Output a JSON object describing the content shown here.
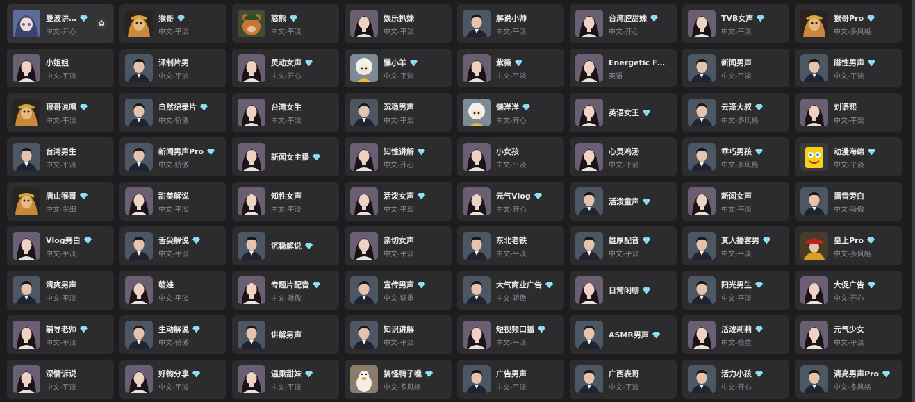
{
  "voices": [
    {
      "name": "曼波讲…",
      "style": "中文-开心",
      "vip": true,
      "avatar": "anime",
      "fav_icon": "flower-icon"
    },
    {
      "name": "猴哥",
      "style": "中文-平淡",
      "vip": true,
      "avatar": "monkey"
    },
    {
      "name": "憨熊",
      "style": "中文-平淡",
      "vip": true,
      "avatar": "bear"
    },
    {
      "name": "娱乐扒妹",
      "style": "中文-平淡",
      "vip": false,
      "avatar": "female"
    },
    {
      "name": "解说小帅",
      "style": "中文-平淡",
      "vip": false,
      "avatar": "male"
    },
    {
      "name": "台湾腔甜妹",
      "style": "中文-开心",
      "vip": true,
      "avatar": "female"
    },
    {
      "name": "TVB女声",
      "style": "中文-平淡",
      "vip": true,
      "avatar": "female"
    },
    {
      "name": "猴哥Pro",
      "style": "中文-多风格",
      "vip": true,
      "avatar": "monkey"
    },
    {
      "name": "小姐姐",
      "style": "中文-平淡",
      "vip": false,
      "avatar": "female"
    },
    {
      "name": "译制片男",
      "style": "中文-平淡",
      "vip": false,
      "avatar": "male"
    },
    {
      "name": "灵动女声",
      "style": "中文-开心",
      "vip": true,
      "avatar": "female"
    },
    {
      "name": "懒小羊",
      "style": "中文-平淡",
      "vip": true,
      "avatar": "sheep"
    },
    {
      "name": "紫薇",
      "style": "中文-平淡",
      "vip": true,
      "avatar": "female"
    },
    {
      "name": "Energetic Fe…",
      "style": "英语",
      "vip": false,
      "avatar": "female"
    },
    {
      "name": "新闻男声",
      "style": "中文-平淡",
      "vip": false,
      "avatar": "male"
    },
    {
      "name": "磁性男声",
      "style": "中文-平淡",
      "vip": true,
      "avatar": "male"
    },
    {
      "name": "猴哥说唱",
      "style": "中文-平淡",
      "vip": true,
      "avatar": "monkey"
    },
    {
      "name": "自然纪录片",
      "style": "中文-骄傲",
      "vip": true,
      "avatar": "male"
    },
    {
      "name": "台湾女生",
      "style": "中文-平淡",
      "vip": false,
      "avatar": "female"
    },
    {
      "name": "沉稳男声",
      "style": "中文-平淡",
      "vip": false,
      "avatar": "male"
    },
    {
      "name": "懒洋洋",
      "style": "中文-开心",
      "vip": true,
      "avatar": "sheep"
    },
    {
      "name": "英语女王",
      "style": "",
      "vip": true,
      "avatar": "female"
    },
    {
      "name": "云泽大叔",
      "style": "中文-多风格",
      "vip": true,
      "avatar": "male"
    },
    {
      "name": "刘语熙",
      "style": "中文-平淡",
      "vip": false,
      "avatar": "female"
    },
    {
      "name": "台湾男生",
      "style": "中文-平淡",
      "vip": false,
      "avatar": "male"
    },
    {
      "name": "新闻男声Pro",
      "style": "中文-骄傲",
      "vip": true,
      "avatar": "male"
    },
    {
      "name": "新闻女主播",
      "style": "",
      "vip": true,
      "avatar": "female"
    },
    {
      "name": "知性讲解",
      "style": "中文-开心",
      "vip": true,
      "avatar": "female"
    },
    {
      "name": "小女孩",
      "style": "中文-平淡",
      "vip": false,
      "avatar": "female"
    },
    {
      "name": "心灵鸡汤",
      "style": "中文-平淡",
      "vip": false,
      "avatar": "female"
    },
    {
      "name": "乖巧男孩",
      "style": "中文-多风格",
      "vip": true,
      "avatar": "male"
    },
    {
      "name": "动漫海绵",
      "style": "中文-平淡",
      "vip": true,
      "avatar": "sponge"
    },
    {
      "name": "唐山猴哥",
      "style": "中文-尖细",
      "vip": true,
      "avatar": "monkey"
    },
    {
      "name": "甜美解说",
      "style": "中文-平淡",
      "vip": false,
      "avatar": "female"
    },
    {
      "name": "知性女声",
      "style": "中文-平淡",
      "vip": false,
      "avatar": "female"
    },
    {
      "name": "活泼女声",
      "style": "中文-平淡",
      "vip": true,
      "avatar": "female"
    },
    {
      "name": "元气Vlog",
      "style": "中文-开心",
      "vip": true,
      "avatar": "female"
    },
    {
      "name": "活泼童声",
      "style": "",
      "vip": true,
      "avatar": "male"
    },
    {
      "name": "新闻女声",
      "style": "中文-平淡",
      "vip": false,
      "avatar": "female"
    },
    {
      "name": "播音旁白",
      "style": "中文-骄傲",
      "vip": false,
      "avatar": "male"
    },
    {
      "name": "Vlog旁白",
      "style": "中文-平淡",
      "vip": true,
      "avatar": "female"
    },
    {
      "name": "舌尖解说",
      "style": "中文-平淡",
      "vip": true,
      "avatar": "male"
    },
    {
      "name": "沉稳解说",
      "style": "",
      "vip": true,
      "avatar": "male"
    },
    {
      "name": "亲切女声",
      "style": "中文-平淡",
      "vip": false,
      "avatar": "female"
    },
    {
      "name": "东北老铁",
      "style": "中文-平淡",
      "vip": false,
      "avatar": "male"
    },
    {
      "name": "雄厚配音",
      "style": "中文-平淡",
      "vip": true,
      "avatar": "male"
    },
    {
      "name": "真人播客男",
      "style": "中文-平淡",
      "vip": true,
      "avatar": "male"
    },
    {
      "name": "皇上Pro",
      "style": "中文-多风格",
      "vip": true,
      "avatar": "emperor"
    },
    {
      "name": "清爽男声",
      "style": "中文-平淡",
      "vip": false,
      "avatar": "male"
    },
    {
      "name": "萌娃",
      "style": "中文-平淡",
      "vip": false,
      "avatar": "female"
    },
    {
      "name": "专题片配音",
      "style": "中文-骄傲",
      "vip": true,
      "avatar": "female"
    },
    {
      "name": "宣传男声",
      "style": "中文-稳重",
      "vip": true,
      "avatar": "male"
    },
    {
      "name": "大气商业广告",
      "style": "中文-骄傲",
      "vip": true,
      "avatar": "male"
    },
    {
      "name": "日常闲聊",
      "style": "",
      "vip": true,
      "avatar": "female"
    },
    {
      "name": "阳光男生",
      "style": "中文-平淡",
      "vip": true,
      "avatar": "male"
    },
    {
      "name": "大促广告",
      "style": "中文-开心",
      "vip": true,
      "avatar": "female"
    },
    {
      "name": "辅导老师",
      "style": "中文-平淡",
      "vip": true,
      "avatar": "female"
    },
    {
      "name": "生动解说",
      "style": "中文-骄傲",
      "vip": true,
      "avatar": "male"
    },
    {
      "name": "讲解男声",
      "style": "",
      "vip": false,
      "avatar": "male"
    },
    {
      "name": "知识讲解",
      "style": "中文-平淡",
      "vip": false,
      "avatar": "male"
    },
    {
      "name": "短视频口播",
      "style": "中文-平淡",
      "vip": true,
      "avatar": "female"
    },
    {
      "name": "ASMR男声",
      "style": "",
      "vip": true,
      "avatar": "male"
    },
    {
      "name": "活泼莉莉",
      "style": "中文-稳重",
      "vip": true,
      "avatar": "female"
    },
    {
      "name": "元气少女",
      "style": "中文-平淡",
      "vip": false,
      "avatar": "female"
    },
    {
      "name": "深情诉说",
      "style": "中文-平淡",
      "vip": false,
      "avatar": "female"
    },
    {
      "name": "好物分享",
      "style": "中文-平淡",
      "vip": true,
      "avatar": "female"
    },
    {
      "name": "温柔甜妹",
      "style": "中文-平淡",
      "vip": true,
      "avatar": "female"
    },
    {
      "name": "搞怪鸭子嗓",
      "style": "中文-多风格",
      "vip": true,
      "avatar": "duck"
    },
    {
      "name": "广告男声",
      "style": "中文-平淡",
      "vip": false,
      "avatar": "male"
    },
    {
      "name": "广西表哥",
      "style": "中文-平淡",
      "vip": false,
      "avatar": "male"
    },
    {
      "name": "活力小孩",
      "style": "中文-开心",
      "vip": true,
      "avatar": "male"
    },
    {
      "name": "清亮男声Pro",
      "style": "中文-多风格",
      "vip": true,
      "avatar": "male"
    }
  ],
  "colors": {
    "card_bg": "#2c2c2f",
    "page_bg": "#1d1d1f",
    "gem": "#7fd8f2",
    "name_text": "#e8e8ea",
    "sub_text": "#8b8b90"
  }
}
